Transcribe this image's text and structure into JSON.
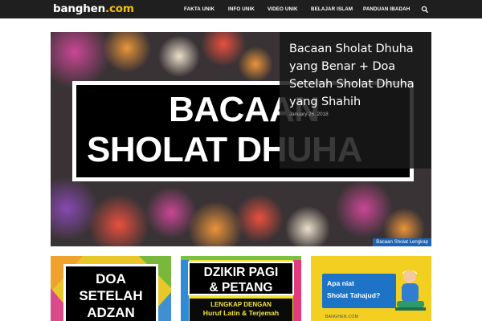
{
  "site": {
    "logo_main": "banghen",
    "logo_accent": ".com"
  },
  "nav": {
    "items": [
      "FAKTA UNIK",
      "INFO UNIK",
      "VIDEO UNIK",
      "BELAJAR ISLAM",
      "PANDUAN IBADAH"
    ],
    "search_icon": "search-icon"
  },
  "featured": {
    "title": "Bacaan Sholat Dhuha yang Benar + Doa Setelah Sholat Dhuha yang Shahih",
    "date": "January 26, 2018",
    "category": "Bacaan Sholat Lengkap",
    "image_text": [
      "BACAAN",
      "SHOLAT DHUHA"
    ]
  },
  "thumbnails": [
    {
      "lines": [
        "DOA",
        "SETELAH",
        "ADZAN"
      ]
    },
    {
      "lines": [
        "DZIKIR PAGI",
        "& PETANG"
      ],
      "sub_lines": [
        "LENGKAP DENGAN",
        "Huruf Latin & Terjemah"
      ]
    },
    {
      "lines": [
        "Apa niat",
        "Sholat Tahajud?"
      ],
      "footer": "BANGHEN.COM"
    }
  ],
  "colors": {
    "topbar": "#1f1f1f",
    "logo_accent": "#f4c20d",
    "category_badge": "#1a63b5",
    "thumb_blue": "#1d74c7",
    "thumb_yellow": "#f1e433"
  }
}
